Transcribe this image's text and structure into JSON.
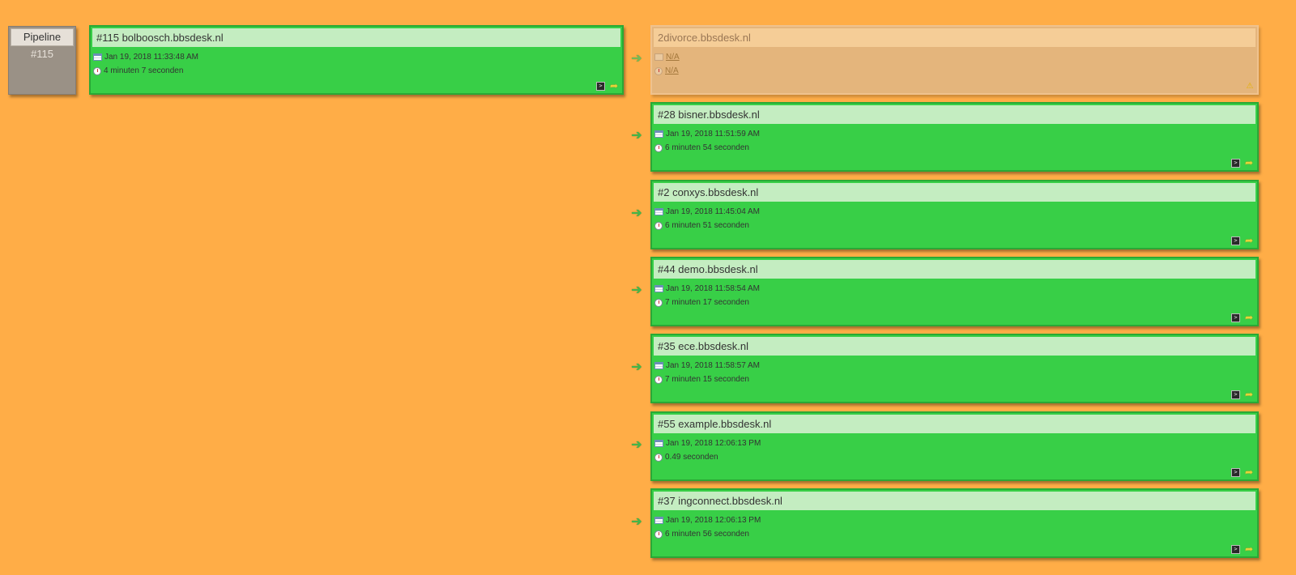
{
  "pipeline": {
    "label": "Pipeline",
    "number": "#115"
  },
  "root_build": {
    "title": "#115 bolboosch.bbsdesk.nl",
    "date": "Jan 19, 2018 11:33:48 AM",
    "duration": "4 minuten 7 seconden",
    "status": "success"
  },
  "downstream": [
    {
      "title": "2divorce.bbsdesk.nl",
      "date": "N/A",
      "duration": "N/A",
      "status": "pending"
    },
    {
      "title": "#28 bisner.bbsdesk.nl",
      "date": "Jan 19, 2018 11:51:59 AM",
      "duration": "6 minuten 54 seconden",
      "status": "success"
    },
    {
      "title": "#2 conxys.bbsdesk.nl",
      "date": "Jan 19, 2018 11:45:04 AM",
      "duration": "6 minuten 51 seconden",
      "status": "success"
    },
    {
      "title": "#44 demo.bbsdesk.nl",
      "date": "Jan 19, 2018 11:58:54 AM",
      "duration": "7 minuten 17 seconden",
      "status": "success"
    },
    {
      "title": "#35 ece.bbsdesk.nl",
      "date": "Jan 19, 2018 11:58:57 AM",
      "duration": "7 minuten 15 seconden",
      "status": "success"
    },
    {
      "title": "#55 example.bbsdesk.nl",
      "date": "Jan 19, 2018 12:06:13 PM",
      "duration": "0.49 seconden",
      "status": "success"
    },
    {
      "title": "#37 ingconnect.bbsdesk.nl",
      "date": "Jan 19, 2018 12:06:13 PM",
      "duration": "6 minuten 56 seconden",
      "status": "success"
    }
  ],
  "colors": {
    "background": "#ffad47",
    "success": "#38cf47",
    "pending": "#e4b57c"
  },
  "icons": {
    "date": "calendar-icon",
    "duration": "clock-icon",
    "console": "console-icon",
    "rebuild": "rebuild-icon",
    "warning": "warning-icon",
    "arrow": "arrow-right-icon"
  }
}
